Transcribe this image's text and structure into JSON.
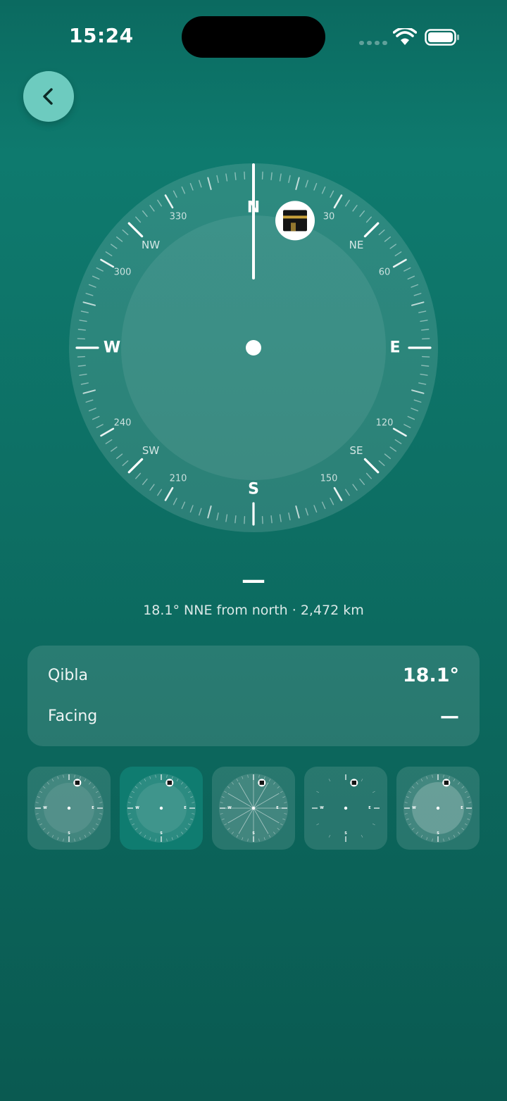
{
  "status_bar": {
    "time": "15:24",
    "icons": [
      "cellular-signal-icon",
      "wifi-icon",
      "battery-icon"
    ]
  },
  "navigation": {
    "back_icon": "chevron-left-icon"
  },
  "compass": {
    "cardinals": {
      "north": "N",
      "east": "E",
      "south": "S",
      "west": "W"
    },
    "intercardinals": {
      "ne": "NE",
      "se": "SE",
      "sw": "SW",
      "nw": "NW"
    },
    "degree_labels": {
      "d30": "30",
      "d60": "60",
      "d120": "120",
      "d150": "150",
      "d210": "210",
      "d240": "240",
      "d300": "300",
      "d330": "330"
    },
    "needle_heading_deg": 0,
    "qibla_marker_deg": 18.1,
    "qibla_marker_icon": "kaaba-icon"
  },
  "readout": {
    "heading": "—",
    "detail": "18.1° NNE from north · 2,472 km"
  },
  "info": {
    "qibla_label": "Qibla",
    "qibla_value": "18.1°",
    "facing_label": "Facing",
    "facing_value": "—"
  },
  "styles": {
    "selected_index": 1,
    "tiles": [
      "style-1",
      "style-2",
      "style-3",
      "style-4",
      "style-5"
    ]
  },
  "colors": {
    "background_top": "#0e7a6e",
    "background_bottom": "#0a5a51",
    "back_button": "#6dcbbf",
    "text": "#ffffff"
  }
}
